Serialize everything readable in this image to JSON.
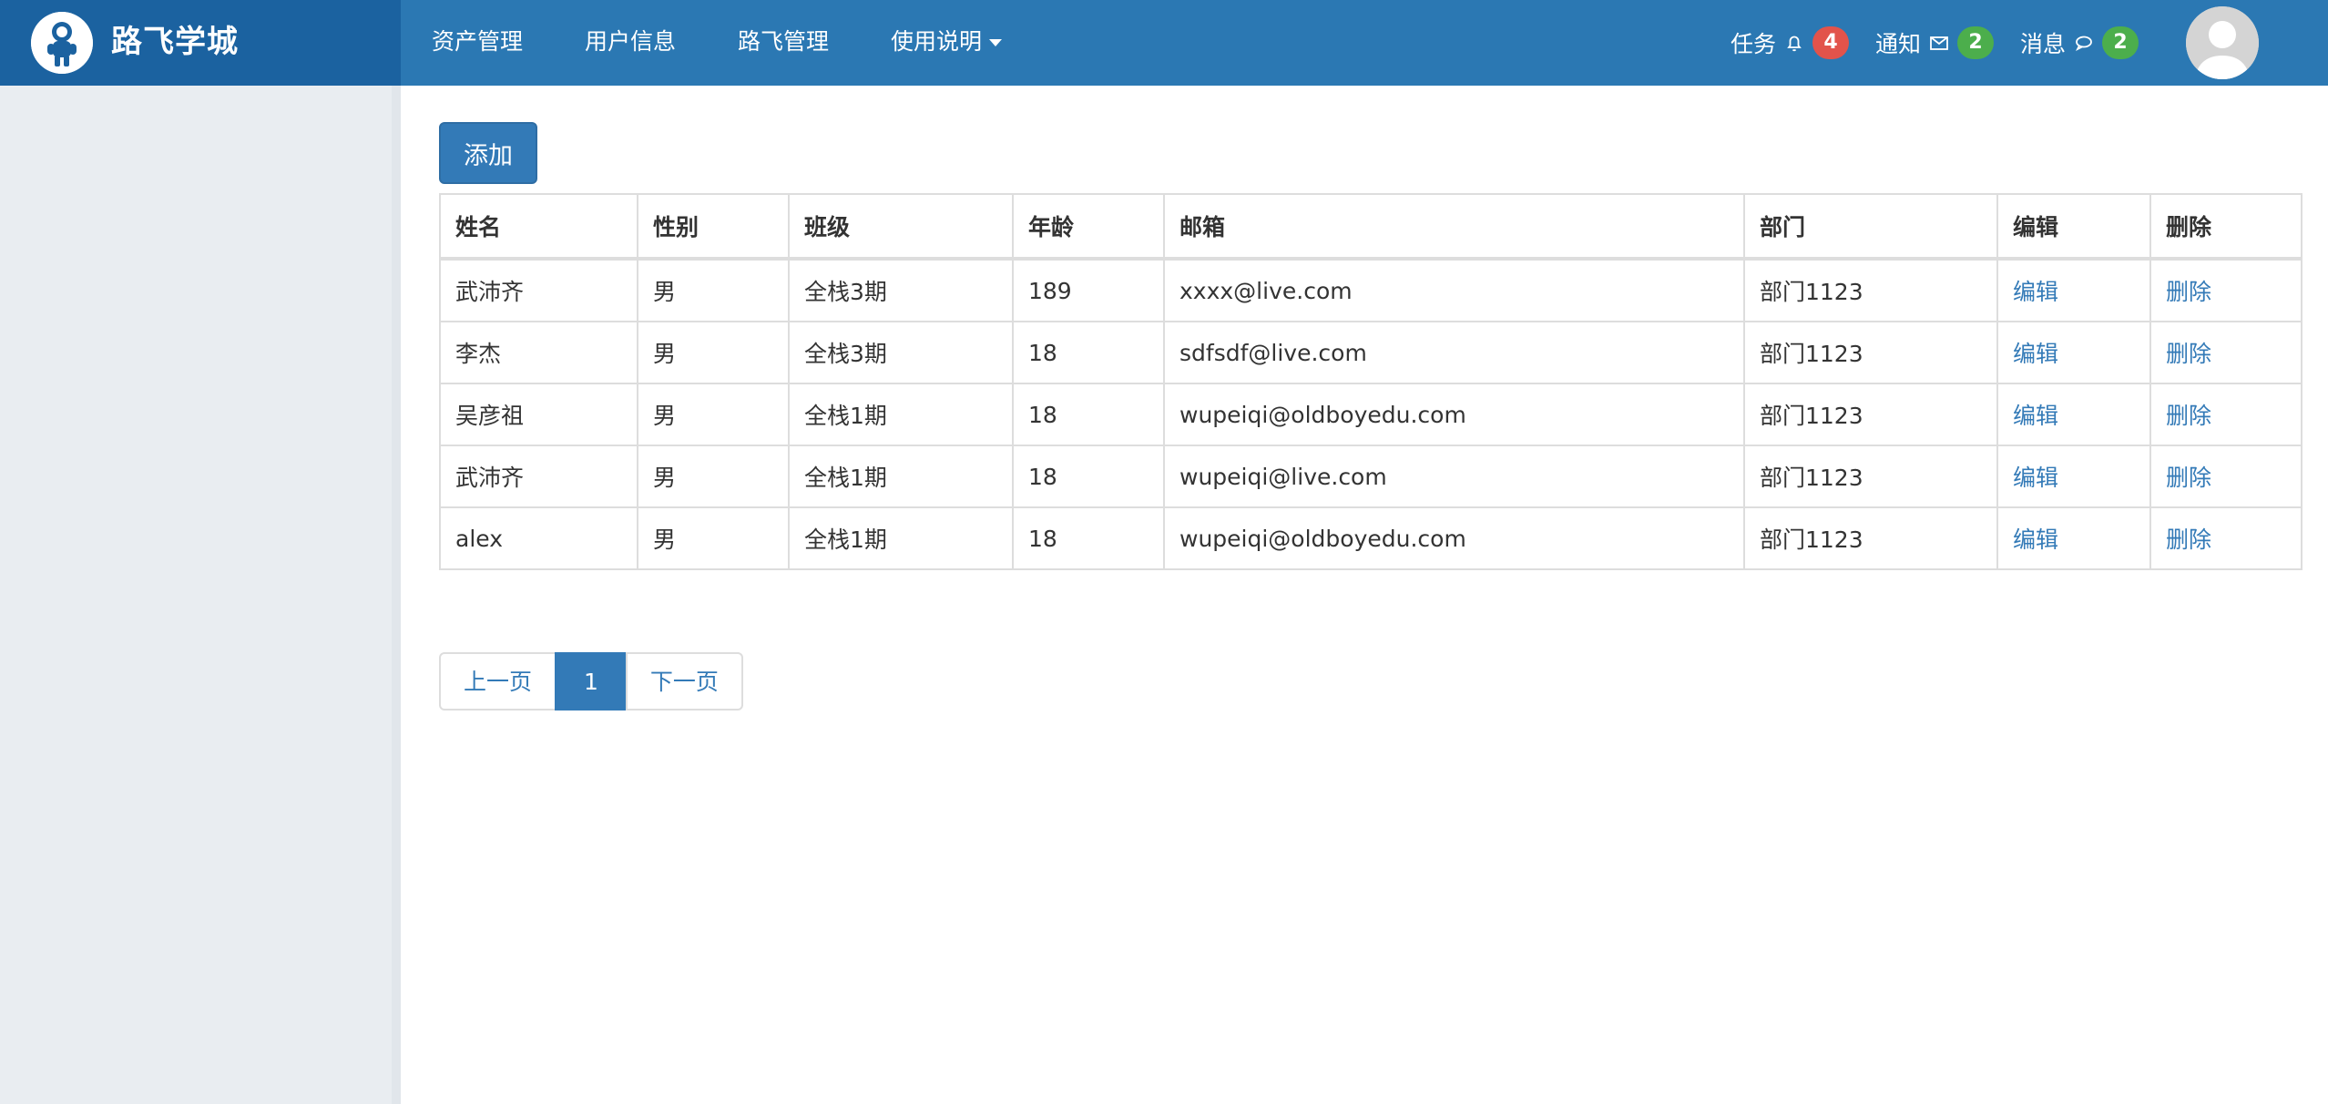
{
  "brand": {
    "title": "路飞学城",
    "logo_icon": "astronaut-logo-icon"
  },
  "menu": [
    {
      "label": "资产管理"
    },
    {
      "label": "用户信息"
    },
    {
      "label": "路飞管理"
    },
    {
      "label": "使用说明",
      "has_dropdown": true
    }
  ],
  "notifications": [
    {
      "label": "任务",
      "icon": "bell-icon",
      "count": "4",
      "color": "#e2534b"
    },
    {
      "label": "通知",
      "icon": "envelope-icon",
      "count": "2",
      "color": "#4cae4c"
    },
    {
      "label": "消息",
      "icon": "chat-bubble-icon",
      "count": "2",
      "color": "#4cae4c"
    }
  ],
  "user": {
    "avatar_icon": "user-avatar-icon"
  },
  "toolbar": {
    "add_label": "添加"
  },
  "table": {
    "headers": [
      "姓名",
      "性别",
      "班级",
      "年龄",
      "邮箱",
      "部门",
      "编辑",
      "删除"
    ],
    "rows": [
      {
        "name": "武沛齐",
        "gender": "男",
        "class": "全栈3期",
        "age": "189",
        "email": "xxxx@live.com",
        "dept": "部门1123",
        "edit": "编辑",
        "delete": "删除"
      },
      {
        "name": "李杰",
        "gender": "男",
        "class": "全栈3期",
        "age": "18",
        "email": "sdfsdf@live.com",
        "dept": "部门1123",
        "edit": "编辑",
        "delete": "删除"
      },
      {
        "name": "吴彦祖",
        "gender": "男",
        "class": "全栈1期",
        "age": "18",
        "email": "wupeiqi@oldboyedu.com",
        "dept": "部门1123",
        "edit": "编辑",
        "delete": "删除"
      },
      {
        "name": "武沛齐",
        "gender": "男",
        "class": "全栈1期",
        "age": "18",
        "email": "wupeiqi@live.com",
        "dept": "部门1123",
        "edit": "编辑",
        "delete": "删除"
      },
      {
        "name": "alex",
        "gender": "男",
        "class": "全栈1期",
        "age": "18",
        "email": "wupeiqi@oldboyedu.com",
        "dept": "部门1123",
        "edit": "编辑",
        "delete": "删除"
      }
    ]
  },
  "pagination": {
    "prev": "上一页",
    "current": "1",
    "next": "下一页"
  },
  "colors": {
    "header_bg": "#2b78b3",
    "brand_bg": "#1b62a0",
    "primary": "#337ab7",
    "sidebar_bg": "#e9edf1"
  }
}
